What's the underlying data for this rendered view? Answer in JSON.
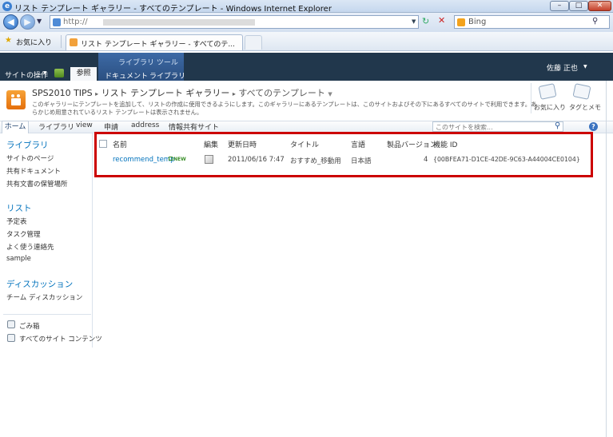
{
  "window": {
    "title": "リスト テンプレート ギャラリー - すべてのテンプレート - Windows Internet Explorer",
    "minimize": "–",
    "maximize": "□",
    "close": "✕"
  },
  "address_bar": {
    "url_prefix": "http://",
    "search_engine": "Bing"
  },
  "favorites_bar": {
    "favorites_label": "お気に入り",
    "tab_title": "リスト テンプレート ギャラリー - すべてのテ..."
  },
  "ribbon": {
    "site_actions": "サイトの操作",
    "browse": "参照",
    "contextual_group": "ライブラリ ツール",
    "tab_documents": "ドキュメント",
    "tab_library": "ライブラリ",
    "user_name": "佐藤 正也"
  },
  "header": {
    "site_name": "SPS2010 TIPS",
    "separator": "▸",
    "page_name": "リスト テンプレート ギャラリー",
    "view_name": "すべてのテンプレート",
    "description_line1": "このギャラリーにテンプレートを追加して、リストの作成に使用できるようにします。このギャラリーにあるテンプレートは、このサイトおよびその下にあるすべてのサイトで利用できます。あ",
    "description_line2": "らかじめ用意されているリスト テンプレートは表示されません。",
    "like_it": "お気に入り",
    "tags_notes": "タグとメモ"
  },
  "topnav": {
    "home": "ホーム",
    "items": [
      "ライブラリ",
      "view",
      "申請",
      "address",
      "情報共有サイト"
    ],
    "search_placeholder": "このサイトを検索...",
    "help": "?"
  },
  "leftnav": {
    "libraries_heading": "ライブラリ",
    "libraries": [
      "サイトのページ",
      "共有ドキュメント",
      "共有文書の保管場所"
    ],
    "lists_heading": "リスト",
    "lists": [
      "予定表",
      "タスク管理",
      "よく使う連絡先",
      "sample"
    ],
    "discussions_heading": "ディスカッション",
    "discussions": [
      "チーム ディスカッション"
    ],
    "recycle_bin": "ごみ箱",
    "all_site_content": "すべてのサイト コンテンツ"
  },
  "list": {
    "columns": [
      "名前",
      "編集",
      "更新日時",
      "タイトル",
      "言語",
      "製品バージョン",
      "機能 ID"
    ],
    "rows": [
      {
        "name": "recommend_temp",
        "new_badge": "NEW",
        "modified": "2011/06/16 7:47",
        "title": "おすすめ_移動用",
        "language": "日本語",
        "product_version": "4",
        "feature_id": "{00BFEA71-D1CE-42DE-9C63-A44004CE0104}"
      }
    ]
  },
  "colors": {
    "ribbon_bg": "#21374c",
    "link_blue": "#0072bc",
    "highlight_red": "#cc0000"
  }
}
